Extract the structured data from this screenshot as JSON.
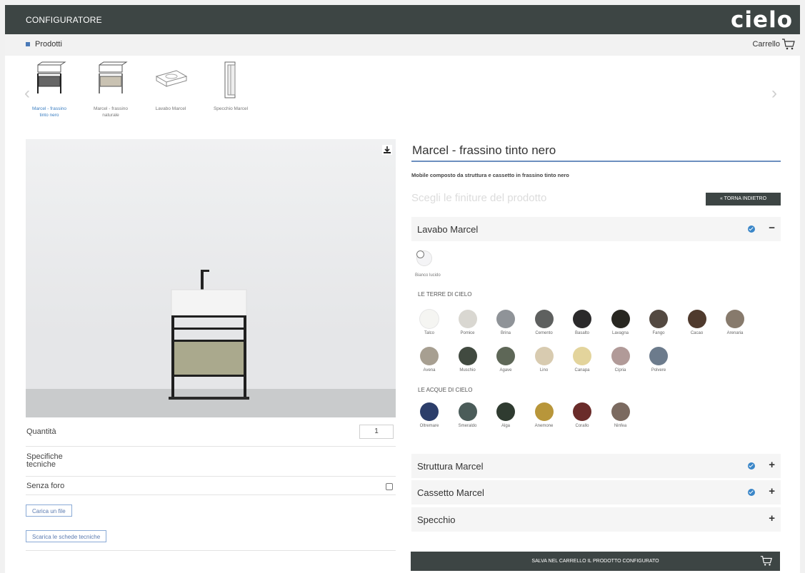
{
  "header": {
    "title": "CONFIGURATORE",
    "logo": "cielo"
  },
  "subbar": {
    "breadcrumb": "Prodotti",
    "cart_label": "Carrello",
    "cart_icon": "cart-icon"
  },
  "nav": {
    "prev_icon": "chevron-left-icon",
    "next_icon": "chevron-right-icon",
    "prev_glyph": "‹",
    "next_glyph": "›"
  },
  "thumbs": [
    {
      "line1": "Marcel - frassino",
      "line2": "tinto nero",
      "active": true
    },
    {
      "line1": "Marcel - frassino",
      "line2": "naturale",
      "active": false
    },
    {
      "line1": "Lavabo Marcel",
      "line2": "",
      "active": false
    },
    {
      "line1": "Specchio Marcel",
      "line2": "",
      "active": false
    }
  ],
  "left": {
    "download_icon": "download-icon",
    "quantity_label": "Quantità",
    "quantity_value": "1",
    "specs_label": "Specifiche tecniche",
    "no_hole_label": "Senza foro",
    "upload_button": "Carica un file",
    "download_button": "Scarica le schede tecniche"
  },
  "product": {
    "title": "Marcel - frassino tinto nero",
    "description": "Mobile composto da struttura e cassetto in frassino tinto nero",
    "choose_finish": "Scegli le finiture del prodotto",
    "back_button": "« TORNA INDIETRO"
  },
  "sections": {
    "lavabo": {
      "name": "Lavabo Marcel",
      "toggle": "−"
    },
    "struttura": {
      "name": "Struttura Marcel",
      "toggle": "+"
    },
    "cassetto": {
      "name": "Cassetto Marcel",
      "toggle": "+"
    },
    "specchio": {
      "name": "Specchio",
      "toggle": "+"
    }
  },
  "finishes": {
    "white": {
      "name": "Bianco lucido",
      "color": "#f4f4f6"
    },
    "terre_title": "LE TERRE DI CIELO",
    "terre_row1": [
      {
        "name": "Talco",
        "color": "#f5f5f2"
      },
      {
        "name": "Pomice",
        "color": "#d9d7d1"
      },
      {
        "name": "Brina",
        "color": "#8f9398"
      },
      {
        "name": "Cemento",
        "color": "#5e605f"
      },
      {
        "name": "Basalto",
        "color": "#2b2a2b"
      },
      {
        "name": "Lavagna",
        "color": "#282721"
      },
      {
        "name": "Fango",
        "color": "#534941"
      },
      {
        "name": "Cacao",
        "color": "#4f3a2d"
      },
      {
        "name": "Arenaria",
        "color": "#877a6c"
      }
    ],
    "terre_row2": [
      {
        "name": "Avena",
        "color": "#a79f91"
      },
      {
        "name": "Muschio",
        "color": "#414a40"
      },
      {
        "name": "Agave",
        "color": "#5e6757"
      },
      {
        "name": "Lino",
        "color": "#d8cbb0"
      },
      {
        "name": "Canapa",
        "color": "#e3d49c"
      },
      {
        "name": "Cipria",
        "color": "#b19a98"
      },
      {
        "name": "Polvere",
        "color": "#6c7b8c"
      }
    ],
    "acque_title": "LE ACQUE DI CIELO",
    "acque_row": [
      {
        "name": "Oltremare",
        "color": "#2c3e6a"
      },
      {
        "name": "Smeraldo",
        "color": "#4b5c59"
      },
      {
        "name": "Alga",
        "color": "#2f3b30"
      },
      {
        "name": "Anemone",
        "color": "#b8963a"
      },
      {
        "name": "Corallo",
        "color": "#6a2c2a"
      },
      {
        "name": "Ninfea",
        "color": "#7b6a60"
      }
    ]
  },
  "save_button": "SALVA NEL CARRELLO IL PRODOTTO CONFIGURATO"
}
